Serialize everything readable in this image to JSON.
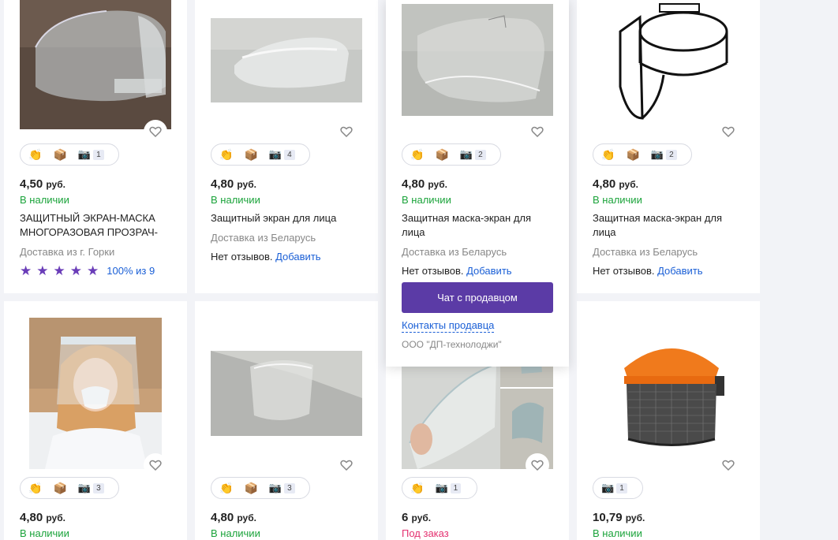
{
  "products": [
    {
      "price": "4,50",
      "currency": "руб.",
      "stock": "В наличии",
      "title": "ЗАЩИТНЫЙ ЭКРАН-МАСКА МНОГОРАЗОВАЯ ПРОЗРАЧ-",
      "delivery": "Доставка из г. Горки",
      "rating_text": "100% из 9",
      "photos": "1"
    },
    {
      "price": "4,80",
      "currency": "руб.",
      "stock": "В наличии",
      "title": "Защитный экран для лица",
      "delivery": "Доставка из Беларусь",
      "reviews": "Нет отзывов.",
      "add": "Добавить",
      "photos": "4"
    },
    {
      "price": "4,80",
      "currency": "руб.",
      "stock": "В наличии",
      "title": "Защитная маска-экран для лица",
      "delivery": "Доставка из Беларусь",
      "reviews": "Нет отзывов.",
      "add": "Добавить",
      "photos": "2",
      "chat": "Чат с продавцом",
      "contacts": "Контакты продавца",
      "company": "ООО \"ДП-технолоджи\""
    },
    {
      "price": "4,80",
      "currency": "руб.",
      "stock": "В наличии",
      "title": "Защитная маска-экран для лица",
      "delivery": "Доставка из Беларусь",
      "reviews": "Нет отзывов.",
      "add": "Добавить",
      "photos": "2"
    },
    {
      "price": "4,80",
      "currency": "руб.",
      "stock": "В наличии",
      "photos": "3"
    },
    {
      "price": "4,80",
      "currency": "руб.",
      "stock": "В наличии",
      "photos": "3"
    },
    {
      "price": "6",
      "currency": "руб.",
      "stock": "Под заказ",
      "photos": "1"
    },
    {
      "price": "10,79",
      "currency": "руб.",
      "stock": "В наличии",
      "photos": "1"
    }
  ],
  "icons": {
    "clap": "👏",
    "box": "📦",
    "camera": "📷"
  },
  "colors": {
    "in_stock": "#1aa33a",
    "on_order": "#e4306f",
    "link": "#1a5fd6",
    "chat_button": "#5b3ba6",
    "star": "#6a3db8"
  }
}
